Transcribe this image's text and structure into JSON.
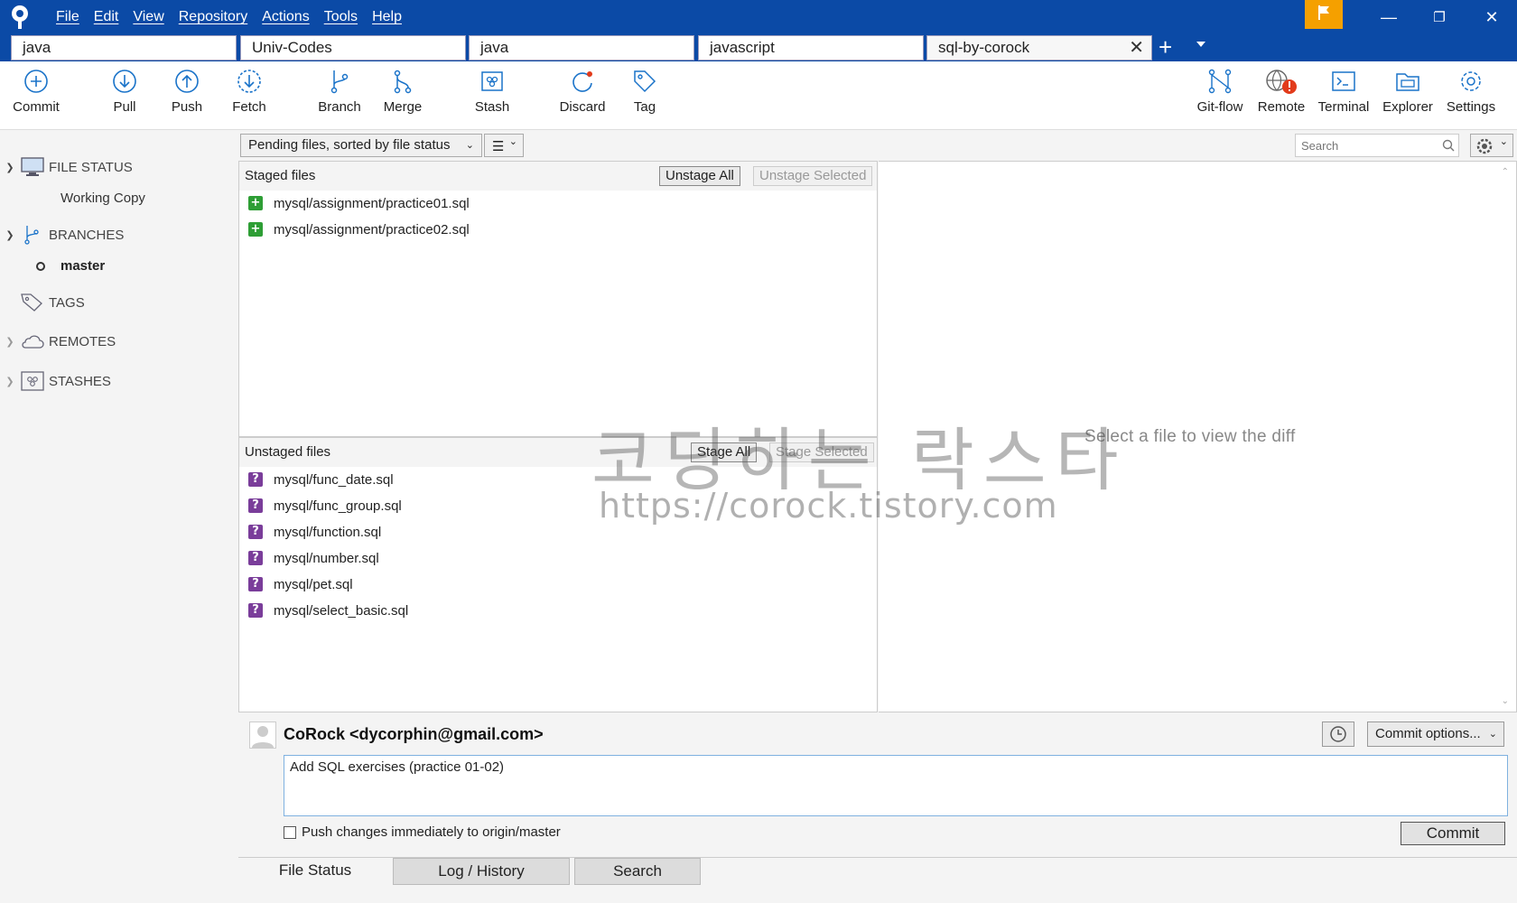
{
  "menu": [
    "File",
    "Edit",
    "View",
    "Repository",
    "Actions",
    "Tools",
    "Help"
  ],
  "tabs": [
    {
      "label": "java"
    },
    {
      "label": "Univ-Codes"
    },
    {
      "label": "java"
    },
    {
      "label": "javascript"
    },
    {
      "label": "sql-by-corock",
      "active": true
    }
  ],
  "toolbar": {
    "left": [
      "Commit",
      "Pull",
      "Push",
      "Fetch",
      "Branch",
      "Merge",
      "Stash",
      "Discard",
      "Tag"
    ],
    "right": [
      "Git-flow",
      "Remote",
      "Terminal",
      "Explorer",
      "Settings"
    ]
  },
  "sidebar": {
    "file_status": "FILE STATUS",
    "working_copy": "Working Copy",
    "branches": "BRANCHES",
    "current_branch": "master",
    "tags": "TAGS",
    "remotes": "REMOTES",
    "stashes": "STASHES"
  },
  "filter": {
    "sort": "Pending files, sorted by file status",
    "search_placeholder": "Search"
  },
  "staged": {
    "title": "Staged files",
    "unstage_all": "Unstage All",
    "unstage_selected": "Unstage Selected",
    "files": [
      "mysql/assignment/practice01.sql",
      "mysql/assignment/practice02.sql"
    ]
  },
  "unstaged": {
    "title": "Unstaged files",
    "stage_all": "Stage All",
    "stage_selected": "Stage Selected",
    "files": [
      "mysql/func_date.sql",
      "mysql/func_group.sql",
      "mysql/function.sql",
      "mysql/number.sql",
      "mysql/pet.sql",
      "mysql/select_basic.sql"
    ]
  },
  "diff": {
    "hint": "Select a file to view the diff"
  },
  "watermark": {
    "korean": "코딩하는 락스타",
    "url": "https://corock.tistory.com"
  },
  "commit": {
    "author": "CoRock <dycorphin@gmail.com>",
    "message": "Add SQL exercises (practice 01-02)",
    "options": "Commit options...",
    "push_label": "Push changes immediately to origin/master",
    "button": "Commit"
  },
  "bottom_tabs": [
    "File Status",
    "Log / History",
    "Search"
  ],
  "colors": {
    "titlebar": "#0b4aa6",
    "accent": "#1a73c9",
    "added": "#2e9e35",
    "untracked": "#7a3d9a",
    "flag": "#f5a000",
    "alert": "#e23b1b"
  }
}
